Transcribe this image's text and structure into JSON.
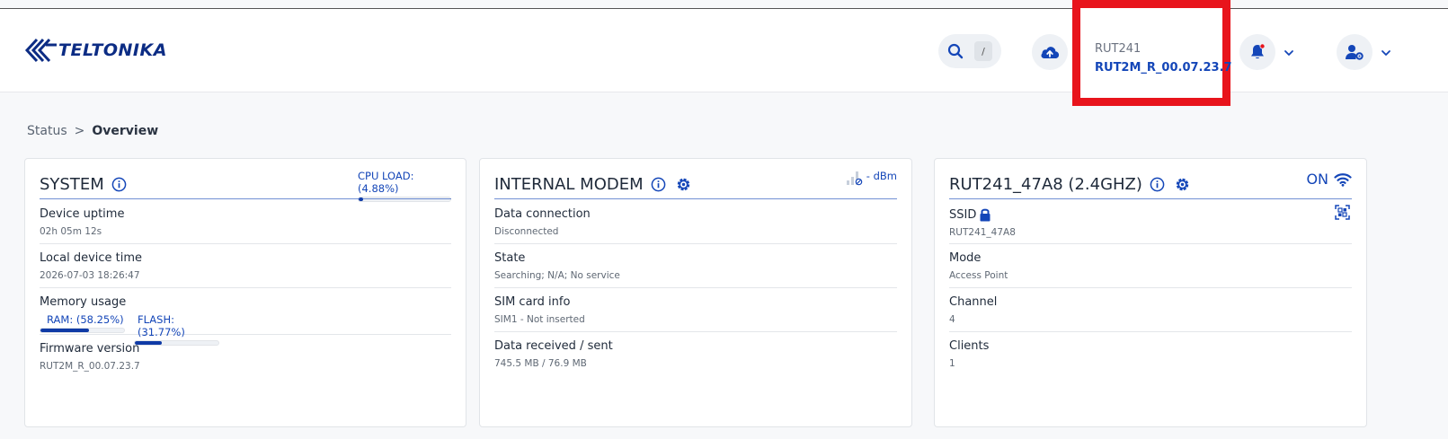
{
  "header": {
    "brand": "TELTONIKA",
    "search_shortcut": "/",
    "device_name": "RUT241",
    "device_firmware": "RUT2M_R_00.07.23.7"
  },
  "breadcrumb": {
    "parent": "Status",
    "separator": ">",
    "current": "Overview"
  },
  "system_card": {
    "title": "SYSTEM",
    "cpu_load_label": "CPU LOAD: (4.88%)",
    "cpu_load_fraction": 0.0488,
    "rows": [
      {
        "label": "Device uptime",
        "value": "02h 05m 12s"
      },
      {
        "label": "Local device time",
        "value": "2026-07-03 18:26:47"
      },
      {
        "label": "Memory usage"
      },
      {
        "label": "Firmware version",
        "value": "RUT2M_R_00.07.23.7"
      }
    ],
    "ram_label": "RAM: (58.25%)",
    "ram_fraction": 0.5825,
    "flash_label": "FLASH: (31.77%)",
    "flash_fraction": 0.3177
  },
  "modem_card": {
    "title": "INTERNAL MODEM",
    "signal_text": "- dBm",
    "rows": [
      {
        "label": "Data connection",
        "value": "Disconnected"
      },
      {
        "label": "State",
        "value": "Searching; N/A; No service"
      },
      {
        "label": "SIM card info",
        "value": "SIM1 - Not inserted"
      },
      {
        "label": "Data received / sent",
        "value": "745.5 MB / 76.9 MB"
      }
    ]
  },
  "wifi_card": {
    "title": "RUT241_47A8 (2.4GHZ)",
    "status": "ON",
    "rows": [
      {
        "label": "SSID",
        "value": "RUT241_47A8"
      },
      {
        "label": "Mode",
        "value": "Access Point"
      },
      {
        "label": "Channel",
        "value": "4"
      },
      {
        "label": "Clients",
        "value": "1"
      }
    ]
  },
  "colors": {
    "accent": "#1446b8",
    "highlight_box": "#e8141c",
    "notification_dot": "#e8141c"
  },
  "icons": [
    "search-icon",
    "upload-cloud-icon",
    "bell-icon",
    "user-settings-icon",
    "info-icon",
    "gear-icon",
    "signal-icon",
    "wifi-icon",
    "lock-icon",
    "qr-code-icon",
    "chevron-down-icon"
  ]
}
